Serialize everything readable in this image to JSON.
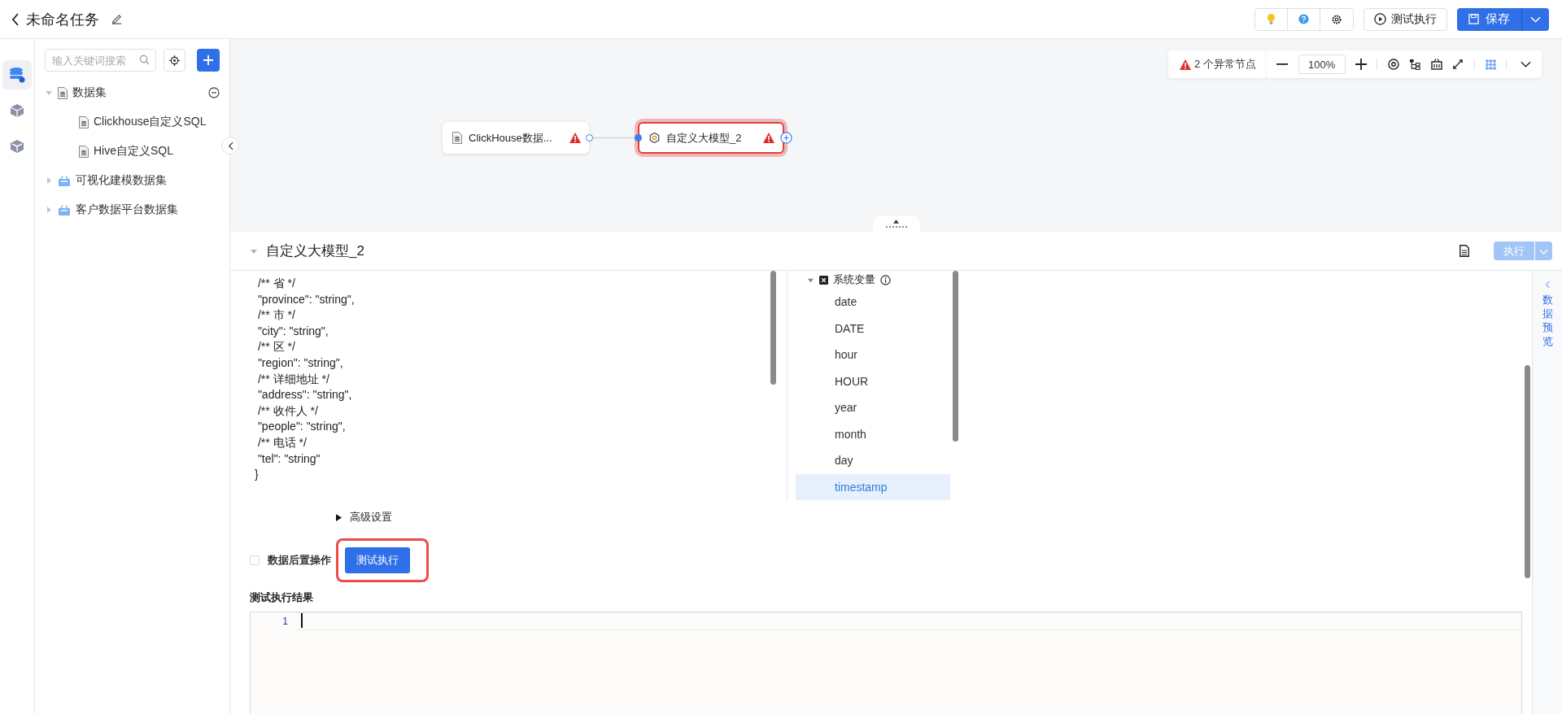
{
  "header": {
    "title": "未命名任务",
    "test_button": "测试执行",
    "save_button": "保存"
  },
  "rail": [
    {
      "kind": "database",
      "selected": true
    },
    {
      "kind": "cube-plus",
      "selected": false
    },
    {
      "kind": "cube",
      "selected": false
    }
  ],
  "sidebar": {
    "search_placeholder": "输入关键词搜索",
    "tree": [
      {
        "label": "数据集",
        "kind": "folder",
        "expanded": true,
        "children": [
          {
            "label": "Clickhouse自定义SQL",
            "kind": "sql"
          },
          {
            "label": "Hive自定义SQL",
            "kind": "sql"
          }
        ]
      },
      {
        "label": "可视化建模数据集",
        "kind": "group",
        "expanded": false
      },
      {
        "label": "客户数据平台数据集",
        "kind": "group",
        "expanded": false
      }
    ]
  },
  "canvas": {
    "alert": "2 个异常节点",
    "zoom": "100%",
    "nodes": [
      {
        "label": "ClickHouse数据...",
        "kind": "source",
        "selected": false,
        "warning": true
      },
      {
        "label": "自定义大模型_2",
        "kind": "model",
        "selected": true,
        "warning": true
      }
    ]
  },
  "panel": {
    "title": "自定义大模型_2",
    "run_button": {
      "label": "执行",
      "disabled": true
    },
    "code_lines": [
      " /** 省 */",
      " \"province\": \"string\",",
      " /** 市 */",
      " \"city\": \"string\",",
      " /** 区 */",
      " \"region\": \"string\",",
      " /** 详细地址 */",
      " \"address\": \"string\",",
      " /** 收件人 */",
      " \"people\": \"string\",",
      " /** 电话 */",
      " \"tel\": \"string\"",
      "}"
    ],
    "variables": {
      "label": "系统变量",
      "expanded": true,
      "items": [
        {
          "label": "date",
          "selected": false
        },
        {
          "label": "DATE",
          "selected": false
        },
        {
          "label": "hour",
          "selected": false
        },
        {
          "label": "HOUR",
          "selected": false
        },
        {
          "label": "year",
          "selected": false
        },
        {
          "label": "month",
          "selected": false
        },
        {
          "label": "day",
          "selected": false
        },
        {
          "label": "timestamp",
          "selected": true
        }
      ]
    },
    "advanced": "高级设置",
    "post_action": {
      "label": "数据后置操作",
      "checked": false
    },
    "test_button": {
      "label": "测试执行",
      "highlighted": true
    },
    "result": {
      "label": "测试执行结果",
      "line_numbers": [
        "1"
      ]
    },
    "side_tab": "数据预览"
  }
}
